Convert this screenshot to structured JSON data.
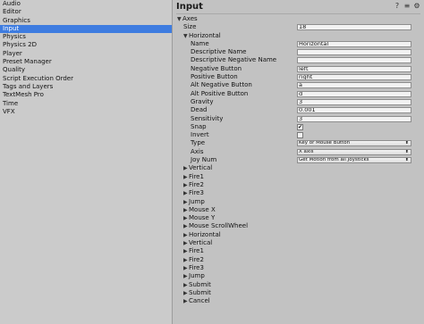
{
  "sidebar": {
    "items": [
      {
        "label": "Audio"
      },
      {
        "label": "Editor"
      },
      {
        "label": "Graphics"
      },
      {
        "label": "Input"
      },
      {
        "label": "Physics"
      },
      {
        "label": "Physics 2D"
      },
      {
        "label": "Player"
      },
      {
        "label": "Preset Manager"
      },
      {
        "label": "Quality"
      },
      {
        "label": "Script Execution Order"
      },
      {
        "label": "Tags and Layers"
      },
      {
        "label": "TextMesh Pro"
      },
      {
        "label": "Time"
      },
      {
        "label": "VFX"
      }
    ],
    "selected_index": 3
  },
  "panel": {
    "title": "Input",
    "icons": [
      "help-icon",
      "preset-icon",
      "settings-icon"
    ]
  },
  "axes": {
    "label": "Axes",
    "size_label": "Size",
    "size_value": "18",
    "expanded": {
      "name": "Horizontal",
      "fields": {
        "name": {
          "label": "Name",
          "value": "Horizontal"
        },
        "descriptive_name": {
          "label": "Descriptive Name",
          "value": ""
        },
        "descriptive_negative_name": {
          "label": "Descriptive Negative Name",
          "value": ""
        },
        "negative_button": {
          "label": "Negative Button",
          "value": "left"
        },
        "positive_button": {
          "label": "Positive Button",
          "value": "right"
        },
        "alt_negative_button": {
          "label": "Alt Negative Button",
          "value": "a"
        },
        "alt_positive_button": {
          "label": "Alt Positive Button",
          "value": "d"
        },
        "gravity": {
          "label": "Gravity",
          "value": "3"
        },
        "dead": {
          "label": "Dead",
          "value": "0.001"
        },
        "sensitivity": {
          "label": "Sensitivity",
          "value": "3"
        },
        "snap": {
          "label": "Snap",
          "checked": true
        },
        "invert": {
          "label": "Invert",
          "checked": false
        },
        "type": {
          "label": "Type",
          "value": "Key or Mouse Button"
        },
        "axis": {
          "label": "Axis",
          "value": "X axis"
        },
        "joy_num": {
          "label": "Joy Num",
          "value": "Get Motion from all Joysticks"
        }
      }
    },
    "collapsed": [
      "Vertical",
      "Fire1",
      "Fire2",
      "Fire3",
      "Jump",
      "Mouse X",
      "Mouse Y",
      "Mouse ScrollWheel",
      "Horizontal",
      "Vertical",
      "Fire1",
      "Fire2",
      "Fire3",
      "Jump",
      "Submit",
      "Submit",
      "Cancel"
    ]
  },
  "colors": {
    "selection": "#3e7ce0",
    "panel_bg": "#c2c2c2",
    "sidebar_bg": "#cbcbcb"
  }
}
